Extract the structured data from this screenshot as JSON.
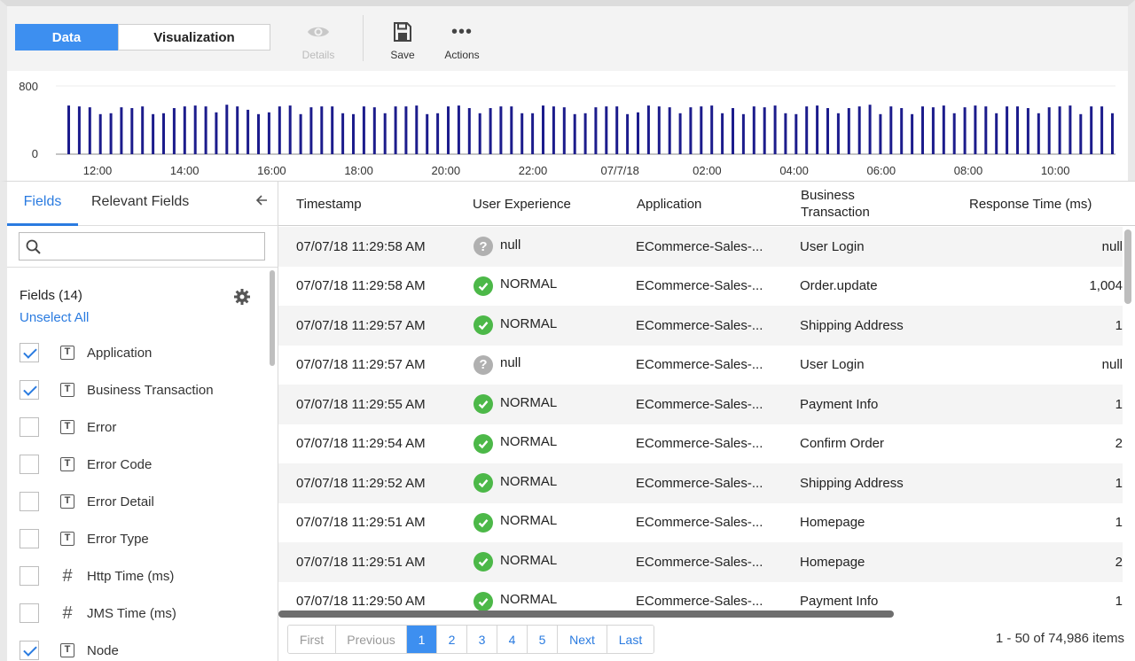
{
  "toolbar": {
    "tabs": {
      "data": "Data",
      "visualization": "Visualization"
    },
    "details_label": "Details",
    "save_label": "Save",
    "actions_label": "Actions",
    "active_tab": "Data"
  },
  "chart_data": {
    "type": "bar",
    "ylim": [
      0,
      800
    ],
    "yticks": [
      "800",
      "0"
    ],
    "xtick_labels": [
      "12:00",
      "14:00",
      "16:00",
      "18:00",
      "20:00",
      "22:00",
      "07/7/18",
      "02:00",
      "04:00",
      "06:00",
      "08:00",
      "10:00"
    ],
    "values": [
      570,
      560,
      550,
      470,
      480,
      550,
      540,
      560,
      470,
      480,
      540,
      560,
      570,
      560,
      490,
      580,
      560,
      520,
      470,
      490,
      560,
      570,
      470,
      550,
      560,
      560,
      480,
      470,
      560,
      550,
      480,
      560,
      560,
      570,
      470,
      480,
      560,
      570,
      540,
      480,
      540,
      560,
      560,
      480,
      480,
      570,
      560,
      550,
      470,
      480,
      550,
      560,
      560,
      470,
      490,
      570,
      560,
      550,
      480,
      550,
      560,
      570,
      480,
      540,
      470,
      560,
      550,
      570,
      480,
      470,
      560,
      570,
      540,
      480,
      540,
      560,
      580,
      470,
      560,
      540,
      470,
      560,
      550,
      570,
      480,
      550,
      570,
      560,
      480,
      560,
      560,
      540,
      480,
      550,
      560,
      570,
      470,
      560,
      560,
      480
    ],
    "bar_color": "#1c1c8c"
  },
  "left_panel": {
    "tab_fields": "Fields",
    "tab_relevant": "Relevant Fields",
    "search_placeholder": "",
    "fields_count": "Fields (14)",
    "unselect_all": "Unselect All",
    "fields": [
      {
        "name": "Application",
        "type": "T",
        "checked": true
      },
      {
        "name": "Business Transaction",
        "type": "T",
        "checked": true
      },
      {
        "name": "Error",
        "type": "T",
        "checked": false
      },
      {
        "name": "Error Code",
        "type": "T",
        "checked": false
      },
      {
        "name": "Error Detail",
        "type": "T",
        "checked": false
      },
      {
        "name": "Error Type",
        "type": "T",
        "checked": false
      },
      {
        "name": "Http Time (ms)",
        "type": "#",
        "checked": false
      },
      {
        "name": "JMS Time (ms)",
        "type": "#",
        "checked": false
      },
      {
        "name": "Node",
        "type": "T",
        "checked": true
      }
    ]
  },
  "table": {
    "columns": [
      "Timestamp",
      "User Experience",
      "Application",
      "Business Transaction",
      "Response Time (ms)"
    ],
    "rows": [
      {
        "timestamp": "07/07/18 11:29:58 AM",
        "ux": "null",
        "ux_status": "unknown",
        "app": "ECommerce-Sales-...",
        "bt": "User Login",
        "rt": "null"
      },
      {
        "timestamp": "07/07/18 11:29:58 AM",
        "ux": "NORMAL",
        "ux_status": "normal",
        "app": "ECommerce-Sales-...",
        "bt": "Order.update",
        "rt": "1,004"
      },
      {
        "timestamp": "07/07/18 11:29:57 AM",
        "ux": "NORMAL",
        "ux_status": "normal",
        "app": "ECommerce-Sales-...",
        "bt": "Shipping Address",
        "rt": "1"
      },
      {
        "timestamp": "07/07/18 11:29:57 AM",
        "ux": "null",
        "ux_status": "unknown",
        "app": "ECommerce-Sales-...",
        "bt": "User Login",
        "rt": "null"
      },
      {
        "timestamp": "07/07/18 11:29:55 AM",
        "ux": "NORMAL",
        "ux_status": "normal",
        "app": "ECommerce-Sales-...",
        "bt": "Payment Info",
        "rt": "1"
      },
      {
        "timestamp": "07/07/18 11:29:54 AM",
        "ux": "NORMAL",
        "ux_status": "normal",
        "app": "ECommerce-Sales-...",
        "bt": "Confirm Order",
        "rt": "2"
      },
      {
        "timestamp": "07/07/18 11:29:52 AM",
        "ux": "NORMAL",
        "ux_status": "normal",
        "app": "ECommerce-Sales-...",
        "bt": "Shipping Address",
        "rt": "1"
      },
      {
        "timestamp": "07/07/18 11:29:51 AM",
        "ux": "NORMAL",
        "ux_status": "normal",
        "app": "ECommerce-Sales-...",
        "bt": "Homepage",
        "rt": "1"
      },
      {
        "timestamp": "07/07/18 11:29:51 AM",
        "ux": "NORMAL",
        "ux_status": "normal",
        "app": "ECommerce-Sales-...",
        "bt": "Homepage",
        "rt": "2"
      },
      {
        "timestamp": "07/07/18 11:29:50 AM",
        "ux": "NORMAL",
        "ux_status": "normal",
        "app": "ECommerce-Sales-...",
        "bt": "Payment Info",
        "rt": "1"
      }
    ]
  },
  "pagination": {
    "first": "First",
    "previous": "Previous",
    "pages": [
      "1",
      "2",
      "3",
      "4",
      "5"
    ],
    "current_page": "1",
    "next": "Next",
    "last": "Last",
    "summary": "1 - 50 of 74,986 items"
  },
  "colors": {
    "accent": "#3d8ff0",
    "link": "#2a7be0",
    "status_ok": "#4cb848",
    "status_unknown": "#b0b0b0"
  }
}
